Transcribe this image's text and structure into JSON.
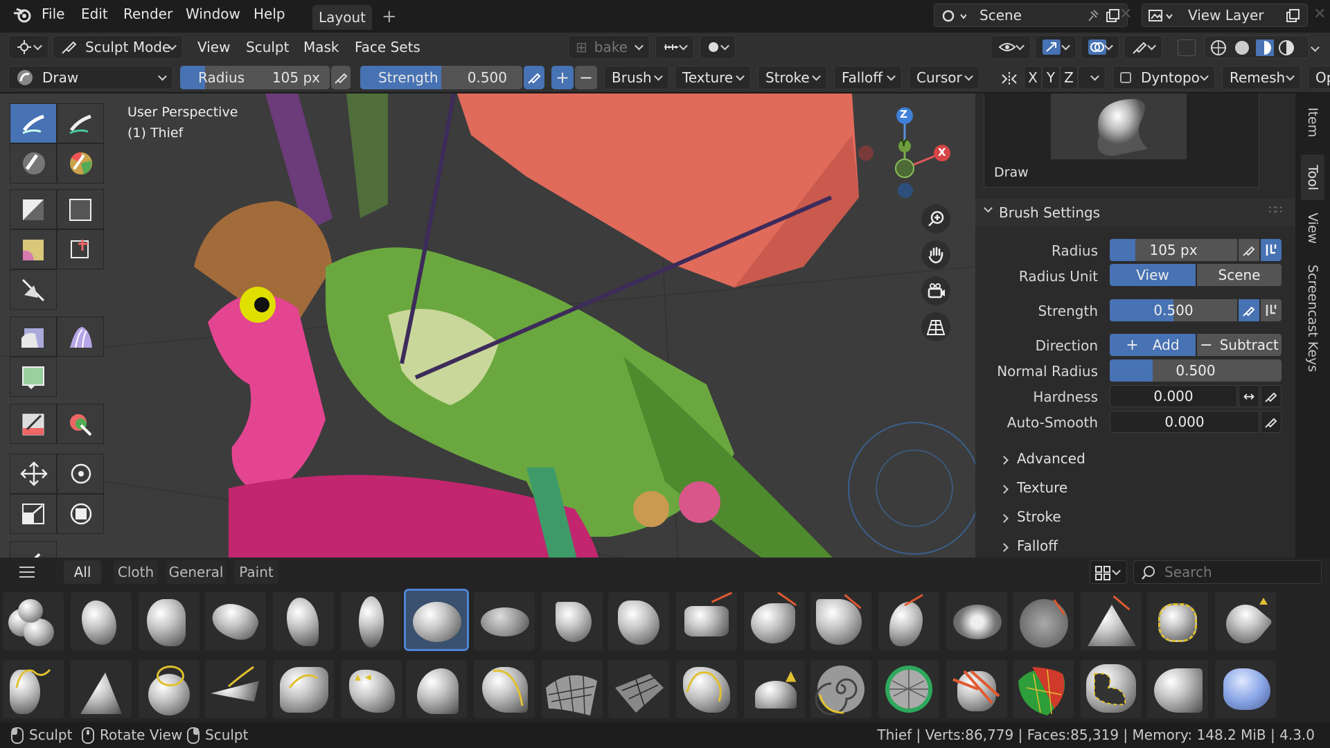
{
  "menu": {
    "items": [
      "File",
      "Edit",
      "Render",
      "Window",
      "Help"
    ],
    "workspace_tab": "Layout",
    "add_tab": "+"
  },
  "scene": {
    "label": "Scene",
    "view_layer": "View Layer"
  },
  "header1": {
    "mode": "Sculpt Mode",
    "menus": [
      "View",
      "Sculpt",
      "Mask",
      "Face Sets"
    ],
    "bake": "bake"
  },
  "header2": {
    "brush": "Draw",
    "radius_label": "Radius",
    "radius_value": "105 px",
    "strength_label": "Strength",
    "strength_value": "0.500",
    "dropdowns": [
      "Brush",
      "Texture",
      "Stroke",
      "Falloff",
      "Cursor"
    ],
    "axes": [
      "X",
      "Y",
      "Z"
    ],
    "dyntopo": "Dyntopo",
    "remesh": "Remesh",
    "cut": "Op"
  },
  "viewport": {
    "perspective": "User Perspective",
    "object": "(1) Thief",
    "gizmo": {
      "z": "Z",
      "y": "Y",
      "x": "X"
    }
  },
  "npanel": {
    "brush_name": "Draw",
    "section": "Brush Settings",
    "radius_label": "Radius",
    "radius_value": "105 px",
    "radius_fill": 0.2,
    "radius_unit_label": "Radius Unit",
    "radius_unit_options": [
      "View",
      "Scene"
    ],
    "radius_unit_selected": "View",
    "strength_label": "Strength",
    "strength_value": "0.500",
    "strength_fill": 0.5,
    "direction_label": "Direction",
    "direction_add": "Add",
    "direction_subtract": "Subtract",
    "normal_radius_label": "Normal Radius",
    "normal_radius_value": "0.500",
    "normal_radius_fill": 0.25,
    "hardness_label": "Hardness",
    "hardness_value": "0.000",
    "autosmooth_label": "Auto-Smooth",
    "autosmooth_value": "0.000",
    "subsections": [
      "Advanced",
      "Texture",
      "Stroke",
      "Falloff"
    ],
    "tabs": [
      "Item",
      "Tool",
      "View",
      "Screencast Keys"
    ]
  },
  "shelf": {
    "tabs": [
      "All",
      "Cloth",
      "General",
      "Paint"
    ],
    "search_placeholder": "Search"
  },
  "status": {
    "items": [
      "Sculpt",
      "Rotate View",
      "Sculpt"
    ],
    "info": "Thief | Verts:86,779 | Faces:85,319 | Memory: 148.2 MiB | 4.3.0"
  },
  "colors": {
    "accent": "#4772b3",
    "panel": "#2b2b2b",
    "header": "#303030"
  }
}
